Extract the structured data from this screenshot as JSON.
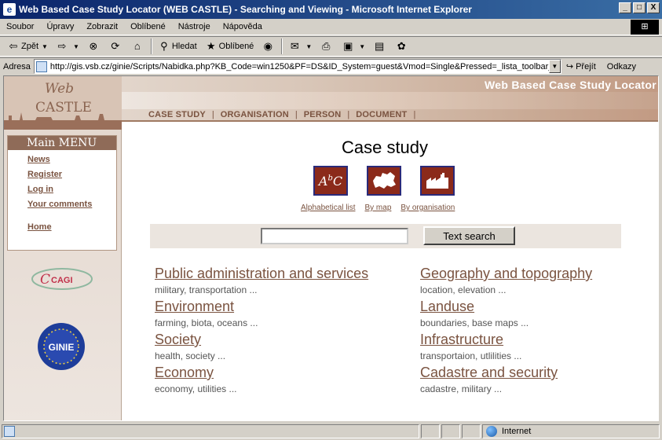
{
  "window": {
    "title": "Web Based Case Study Locator (WEB CASTLE) - Searching and Viewing - Microsoft Internet Explorer",
    "buttons": [
      "_",
      "□",
      "X"
    ]
  },
  "menu": [
    "Soubor",
    "Úpravy",
    "Zobrazit",
    "Oblíbené",
    "Nástroje",
    "Nápověda"
  ],
  "toolbar": {
    "back": "Zpět",
    "search": "Hledat",
    "favorites": "Oblíbené"
  },
  "address": {
    "label": "Adresa",
    "url": "http://gis.vsb.cz/ginie/Scripts/Nabidka.php?KB_Code=win1250&PF=DS&ID_System=guest&Vmod=Single&Pressed=_lista_toolbar_D",
    "go": "Přejít",
    "links": "Odkazy"
  },
  "site": {
    "logo_line1": "Web",
    "logo_line2": "CASTLE",
    "title": "Web Based Case Study Locator",
    "nav": [
      "CASE STUDY",
      "ORGANISATION",
      "PERSON",
      "DOCUMENT"
    ]
  },
  "sidebar": {
    "heading": "Main MENU",
    "items": [
      "News",
      "Register",
      "Log in",
      "Your comments",
      "Home"
    ],
    "logos": {
      "cagi": "CAGI",
      "ginie": "GINIE"
    }
  },
  "main": {
    "title": "Case study",
    "view_links": [
      "Alphabetical list",
      "By map",
      "By organisation"
    ],
    "search_button": "Text search",
    "search_value": "",
    "categories": [
      {
        "title": "Public administration and services",
        "sub": "military, transportation ..."
      },
      {
        "title": "Geography and topography",
        "sub": "location, elevation ..."
      },
      {
        "title": "Environment",
        "sub": "farming, biota, oceans ..."
      },
      {
        "title": "Landuse",
        "sub": "boundaries, base maps ..."
      },
      {
        "title": "Society",
        "sub": "health, society ..."
      },
      {
        "title": "Infrastructure",
        "sub": "transportaion, utlilities ..."
      },
      {
        "title": "Economy",
        "sub": "economy, utilities ..."
      },
      {
        "title": "Cadastre and security",
        "sub": "cadastre, military ..."
      }
    ]
  },
  "status": {
    "zone": "Internet"
  }
}
